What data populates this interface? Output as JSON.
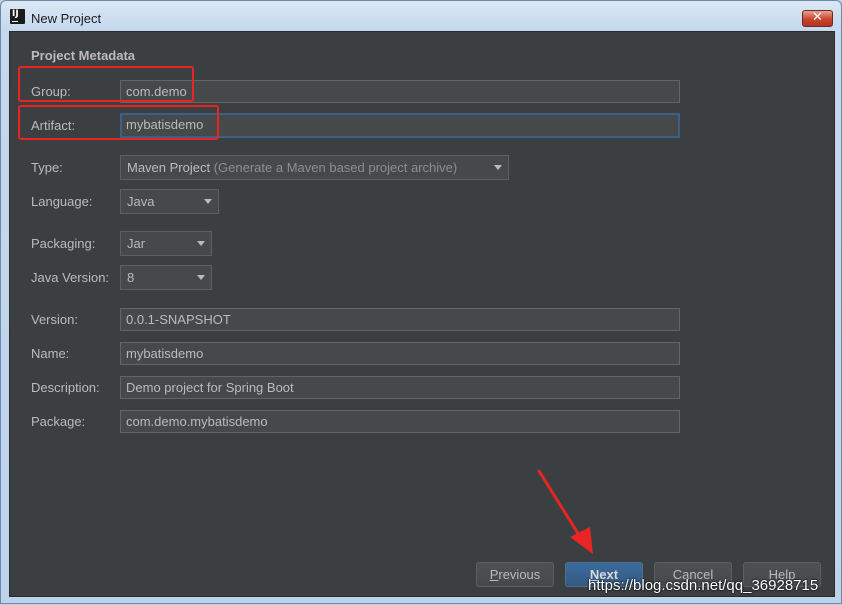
{
  "window": {
    "title": "New Project",
    "app_icon_text": "IJ",
    "close_glyph": "✕"
  },
  "section": {
    "title": "Project Metadata"
  },
  "form": {
    "group": {
      "label": "Group:",
      "value": "com.demo"
    },
    "artifact": {
      "label": "Artifact:",
      "value": "mybatisdemo"
    },
    "type": {
      "label": "Type:",
      "value": "Maven Project",
      "hint": "(Generate a Maven based project archive)"
    },
    "language": {
      "label": "Language:",
      "value": "Java"
    },
    "packaging": {
      "label": "Packaging:",
      "value": "Jar"
    },
    "java_version": {
      "label": "Java Version:",
      "value": "8"
    },
    "version": {
      "label": "Version:",
      "value": "0.0.1-SNAPSHOT"
    },
    "name": {
      "label": "Name:",
      "value": "mybatisdemo"
    },
    "description": {
      "label": "Description:",
      "value": "Demo project for Spring Boot"
    },
    "package": {
      "label": "Package:",
      "value": "com.demo.mybatisdemo"
    }
  },
  "buttons": {
    "previous": {
      "mnemonic": "P",
      "rest": "revious"
    },
    "next": {
      "mnemonic": "N",
      "rest": "ext"
    },
    "cancel": {
      "label": "Cancel"
    },
    "help": {
      "label": "Help"
    }
  },
  "watermark": "https://blog.csdn.net/qq_36928715",
  "colors": {
    "dialog_bg": "#3c3f41",
    "field_bg": "#45494a",
    "text": "#bbbbbb",
    "focus_border": "#3d6185",
    "default_button": "#365880",
    "annotation_red": "#e82424"
  }
}
